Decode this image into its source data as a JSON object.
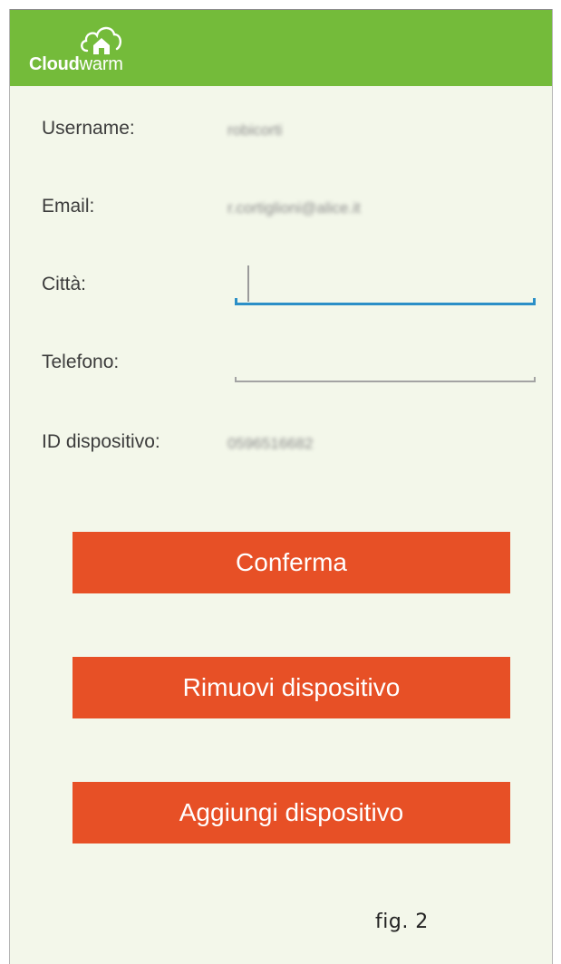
{
  "app": {
    "logo_bold": "Cloud",
    "logo_light": "warm"
  },
  "form": {
    "username_label": "Username:",
    "username_value": "robicorti",
    "email_label": "Email:",
    "email_value": "r.cortiglioni@alice.it",
    "city_label": "Città:",
    "city_value": "",
    "phone_label": "Telefono:",
    "phone_value": "",
    "device_id_label": "ID dispositivo:",
    "device_id_value": "0596516682"
  },
  "buttons": {
    "confirm": "Conferma",
    "remove_device": "Rimuovi dispositivo",
    "add_device": "Aggiungi dispositivo"
  },
  "caption": "fig. 2",
  "colors": {
    "topbar": "#74bb3a",
    "background": "#f3f7ea",
    "button": "#e75026",
    "focus_line": "#2b8fc7"
  },
  "icons": {
    "logo": "cloud-house-icon"
  }
}
